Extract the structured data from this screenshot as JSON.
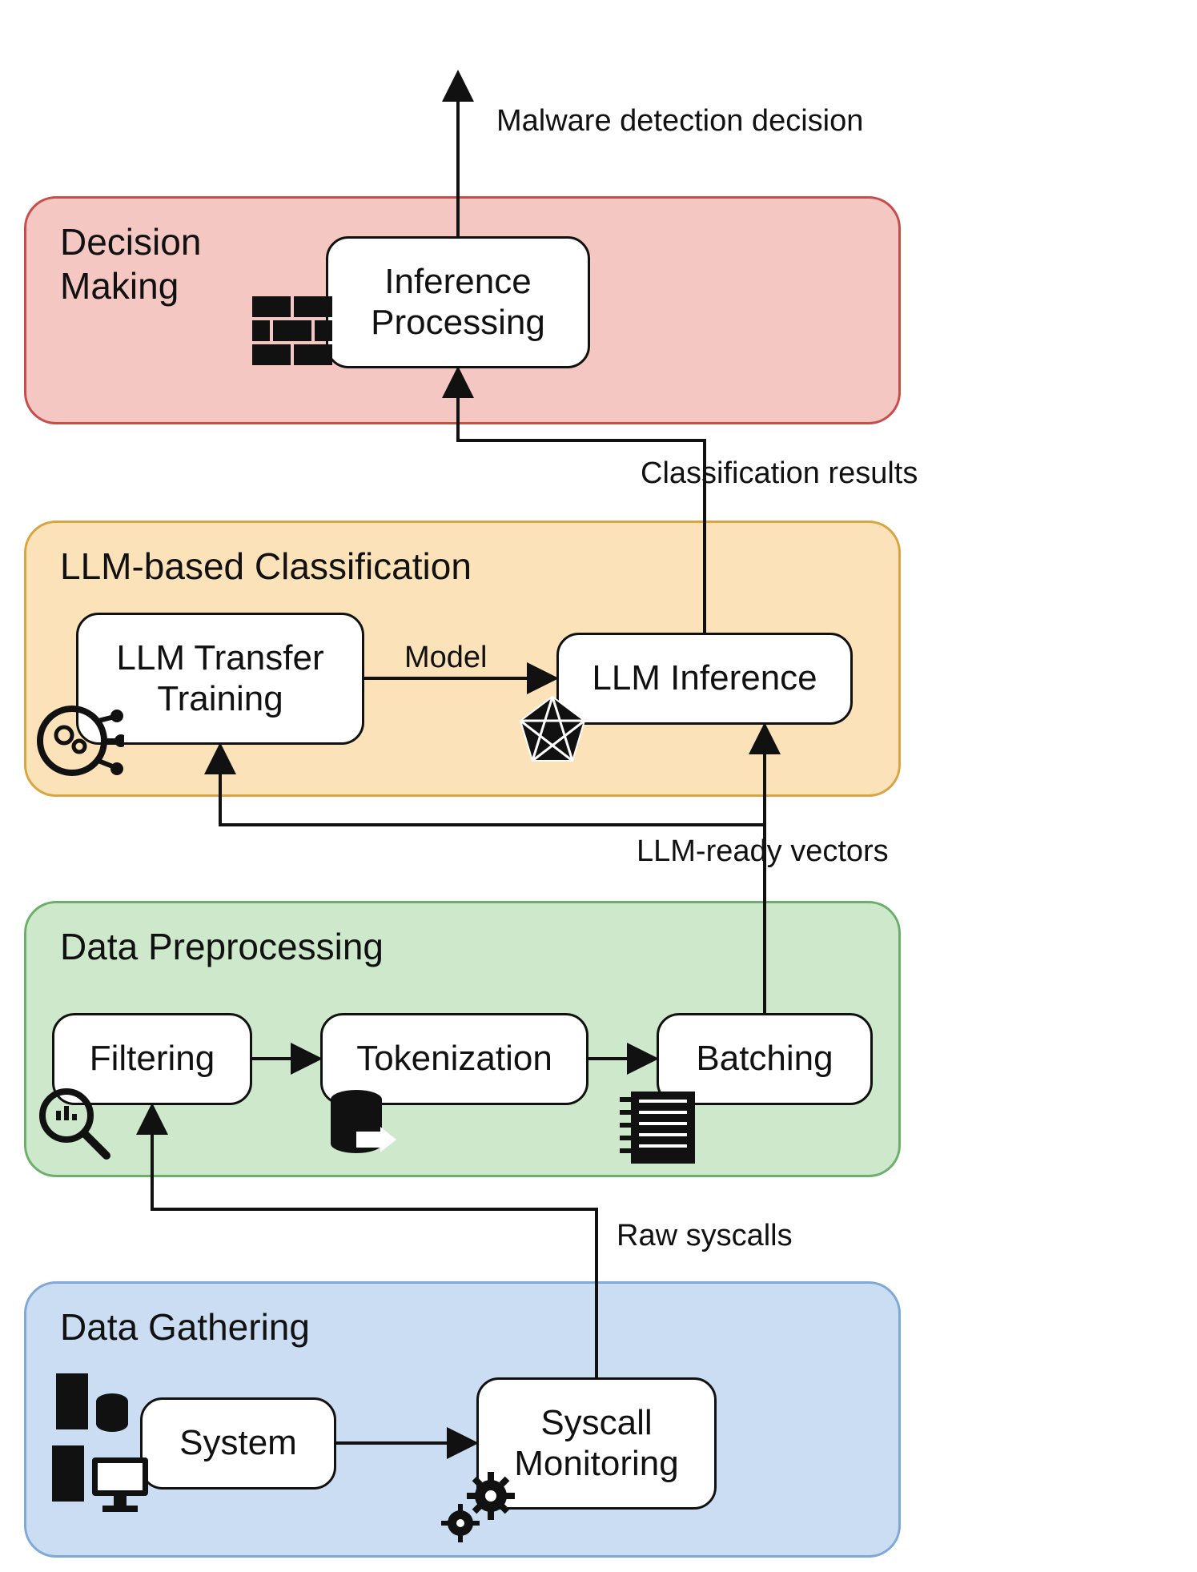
{
  "layers": {
    "decision": {
      "title": "Decision\nMaking"
    },
    "llm": {
      "title": "LLM-based Classification"
    },
    "preproc": {
      "title": "Data Preprocessing"
    },
    "gathering": {
      "title": "Data Gathering"
    }
  },
  "nodes": {
    "inference_processing": {
      "label": "Inference\nProcessing"
    },
    "transfer_training": {
      "label": "LLM Transfer\nTraining"
    },
    "llm_inference": {
      "label": "LLM Inference"
    },
    "filtering": {
      "label": "Filtering"
    },
    "tokenization": {
      "label": "Tokenization"
    },
    "batching": {
      "label": "Batching"
    },
    "system": {
      "label": "System"
    },
    "syscall_monitoring": {
      "label": "Syscall\nMonitoring"
    }
  },
  "edges": {
    "decision_out": {
      "label": "Malware detection decision"
    },
    "classification": {
      "label": "Classification results"
    },
    "model": {
      "label": "Model"
    },
    "vectors": {
      "label": "LLM-ready vectors"
    },
    "raw_syscalls": {
      "label": "Raw syscalls"
    }
  },
  "icons": {
    "firewall": "firewall-icon",
    "gears": "gears-icon",
    "network": "network-icon",
    "magnifier": "magnifier-icon",
    "database": "database-icon",
    "memory": "memory-icon",
    "system": "system-icon",
    "cogs": "cogs-icon"
  }
}
